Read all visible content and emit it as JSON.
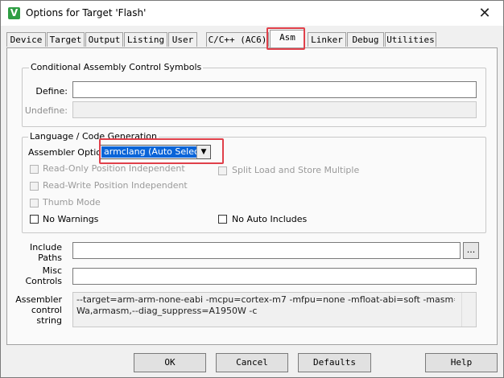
{
  "window": {
    "title": "Options for Target 'Flash'",
    "close_glyph": "✕",
    "icon_glyph": "V"
  },
  "tabs": [
    "Device",
    "Target",
    "Output",
    "Listing",
    "User",
    "C/C++ (AC6)",
    "Asm",
    "Linker",
    "Debug",
    "Utilities"
  ],
  "active_tab": "Asm",
  "conditional": {
    "title": "Conditional Assembly Control Symbols",
    "define_label": "Define:",
    "define_value": "",
    "undefine_label": "Undefine:",
    "undefine_value": ""
  },
  "language": {
    "title": "Language / Code Generation",
    "assembler_option_label": "Assembler Option",
    "assembler_option_value": "armclang (Auto Select)",
    "checkboxes": {
      "read_only_pi": {
        "label": "Read-Only Position Independent",
        "checked": false,
        "enabled": false
      },
      "split_load_store": {
        "label": "Split Load and Store Multiple",
        "checked": false,
        "enabled": false
      },
      "read_write_pi": {
        "label": "Read-Write Position Independent",
        "checked": false,
        "enabled": false
      },
      "thumb_mode": {
        "label": "Thumb Mode",
        "checked": false,
        "enabled": false
      },
      "no_warnings": {
        "label": "No Warnings",
        "checked": false,
        "enabled": true
      },
      "no_auto_includes": {
        "label": "No Auto Includes",
        "checked": false,
        "enabled": true
      }
    }
  },
  "include_paths": {
    "label_line1": "Include",
    "label_line2": "Paths",
    "value": "",
    "browse_label": "..."
  },
  "misc_controls": {
    "label_line1": "Misc",
    "label_line2": "Controls",
    "value": ""
  },
  "assembler_control": {
    "label_line1": "Assembler",
    "label_line2": "control",
    "label_line3": "string",
    "line1": "--target=arm-arm-none-eabi -mcpu=cortex-m7 -mfpu=none -mfloat-abi=soft -masm=auto  -",
    "line2": "Wa,armasm,--diag_suppress=A1950W -c"
  },
  "buttons": {
    "ok": "OK",
    "cancel": "Cancel",
    "defaults": "Defaults",
    "help": "Help"
  },
  "colors": {
    "highlight": "#e0404a",
    "selection": "#0a64d8",
    "icon": "#2f9e44"
  }
}
